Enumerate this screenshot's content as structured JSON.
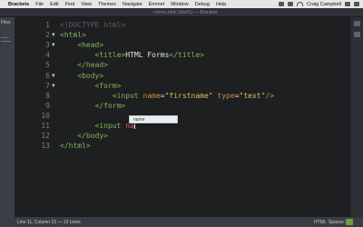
{
  "menubar": {
    "apple": "",
    "app_name": "Brackets",
    "items": [
      "File",
      "Edit",
      "Find",
      "View",
      "Themes",
      "Navigate",
      "Emmet",
      "Window",
      "Debug",
      "Help"
    ],
    "user": "Craig Campbell"
  },
  "window": {
    "title": "• forms.html (site01) — Brackets"
  },
  "sidebar": {
    "label": "Files"
  },
  "editor": {
    "lines": [
      {
        "n": "1",
        "fold": "",
        "segments": [
          {
            "text": "<!DOCTYPE html>",
            "cls": "c-cm"
          }
        ]
      },
      {
        "n": "2",
        "fold": "▼",
        "segments": [
          {
            "text": "<html>",
            "cls": "c-tag"
          }
        ]
      },
      {
        "n": "3",
        "fold": "▼",
        "segments": [
          {
            "text": "    ",
            "cls": "c-txt"
          },
          {
            "text": "<head>",
            "cls": "c-tag"
          }
        ]
      },
      {
        "n": "4",
        "fold": "",
        "segments": [
          {
            "text": "        ",
            "cls": "c-txt"
          },
          {
            "text": "<title>",
            "cls": "c-tag"
          },
          {
            "text": "HTML Forms",
            "cls": "c-txt"
          },
          {
            "text": "</title>",
            "cls": "c-tag"
          }
        ]
      },
      {
        "n": "5",
        "fold": "",
        "segments": [
          {
            "text": "    ",
            "cls": "c-txt"
          },
          {
            "text": "</head>",
            "cls": "c-tag"
          }
        ]
      },
      {
        "n": "6",
        "fold": "▼",
        "segments": [
          {
            "text": "    ",
            "cls": "c-txt"
          },
          {
            "text": "<body>",
            "cls": "c-tag"
          }
        ]
      },
      {
        "n": "7",
        "fold": "▼",
        "segments": [
          {
            "text": "        ",
            "cls": "c-txt"
          },
          {
            "text": "<form>",
            "cls": "c-tag"
          }
        ]
      },
      {
        "n": "8",
        "fold": "",
        "segments": [
          {
            "text": "            ",
            "cls": "c-txt"
          },
          {
            "text": "<input ",
            "cls": "c-tag"
          },
          {
            "text": "name",
            "cls": "c-attr"
          },
          {
            "text": "=",
            "cls": "c-txt"
          },
          {
            "text": "\"firstname\"",
            "cls": "c-val"
          },
          {
            "text": " ",
            "cls": "c-txt"
          },
          {
            "text": "type",
            "cls": "c-attr"
          },
          {
            "text": "=",
            "cls": "c-txt"
          },
          {
            "text": "\"text\"",
            "cls": "c-val"
          },
          {
            "text": "/>",
            "cls": "c-tag"
          }
        ]
      },
      {
        "n": "9",
        "fold": "",
        "segments": [
          {
            "text": "        ",
            "cls": "c-txt"
          },
          {
            "text": "</form>",
            "cls": "c-tag"
          }
        ]
      },
      {
        "n": "10",
        "fold": "",
        "segments": []
      },
      {
        "n": "11",
        "fold": "",
        "segments": [
          {
            "text": "        ",
            "cls": "c-txt"
          },
          {
            "text": "<input ",
            "cls": "c-tag"
          },
          {
            "text": "na",
            "cls": "c-typed"
          }
        ],
        "cursor": true
      },
      {
        "n": "12",
        "fold": "",
        "segments": [
          {
            "text": "    ",
            "cls": "c-txt"
          },
          {
            "text": "</body>",
            "cls": "c-tag"
          }
        ]
      },
      {
        "n": "13",
        "fold": "",
        "segments": [
          {
            "text": "</html>",
            "cls": "c-tag"
          }
        ]
      }
    ]
  },
  "hint": {
    "items": [
      "name"
    ]
  },
  "statusbar": {
    "position": "Line 11, Column 15 — 13 Lines",
    "mode": "HTML",
    "indent": "Spaces: 4"
  },
  "colors": {
    "tag": "#85b45a",
    "attribute": "#d58a3c",
    "value": "#e0c05a",
    "comment": "#5b5e62",
    "background": "#1d1f21"
  }
}
